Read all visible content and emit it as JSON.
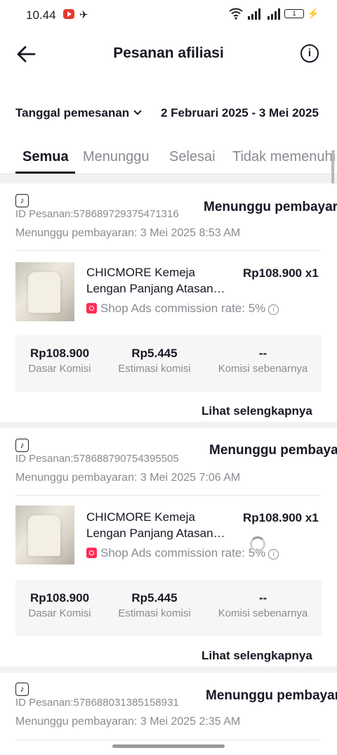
{
  "status_bar": {
    "time": "10.44",
    "telegram_glyph": "✈",
    "battery": "1",
    "bolt": "⚡"
  },
  "header": {
    "title": "Pesanan afiliasi",
    "info_glyph": "i",
    "back_icon": "arrow-left"
  },
  "filter": {
    "label": "Tanggal pemesanan",
    "date_range": "2 Februari 2025 - 3 Mei 2025"
  },
  "tabs": [
    {
      "label": "Semua",
      "active": true
    },
    {
      "label": "Menunggu",
      "active": false
    },
    {
      "label": "Selesai",
      "active": false
    },
    {
      "label": "Tidak memenuhi",
      "active": false
    }
  ],
  "orders": [
    {
      "order_id": "ID Pesanan:578689729375471316",
      "status": "Menunggu pembayaran",
      "wait_time": "Menunggu pembayaran: 3 Mei 2025 8:53 AM",
      "product_name": "CHICMORE Kemeja Lengan Panjang Atasan…",
      "price": "Rp108.900 x1",
      "shop_ads": "Shop Ads commission rate: 5%",
      "base_commission": "Rp108.900",
      "base_commission_label": "Dasar Komisi",
      "est_commission": "Rp5.445",
      "est_commission_label": "Estimasi komisi",
      "actual_commission": "--",
      "actual_commission_label": "Komisi sebenarnya",
      "more": "Lihat selengkapnya"
    },
    {
      "order_id": "ID Pesanan:578688790754395505",
      "status": "Menunggu pembayaran",
      "wait_time": "Menunggu pembayaran: 3 Mei 2025 7:06 AM",
      "product_name": "CHICMORE Kemeja Lengan Panjang Atasan…",
      "price": "Rp108.900 x1",
      "shop_ads": "Shop Ads commission rate: 5%",
      "base_commission": "Rp108.900",
      "base_commission_label": "Dasar Komisi",
      "est_commission": "Rp5.445",
      "est_commission_label": "Estimasi komisi",
      "actual_commission": "--",
      "actual_commission_label": "Komisi sebenarnya",
      "more": "Lihat selengkapnya"
    },
    {
      "order_id": "ID Pesanan:578688031385158931",
      "status": "Menunggu pembayaran",
      "wait_time": "Menunggu pembayaran: 3 Mei 2025 2:35 AM"
    }
  ],
  "colors": {
    "accent": "#fe2c55",
    "text": "#161823",
    "muted": "#8a8b91"
  }
}
